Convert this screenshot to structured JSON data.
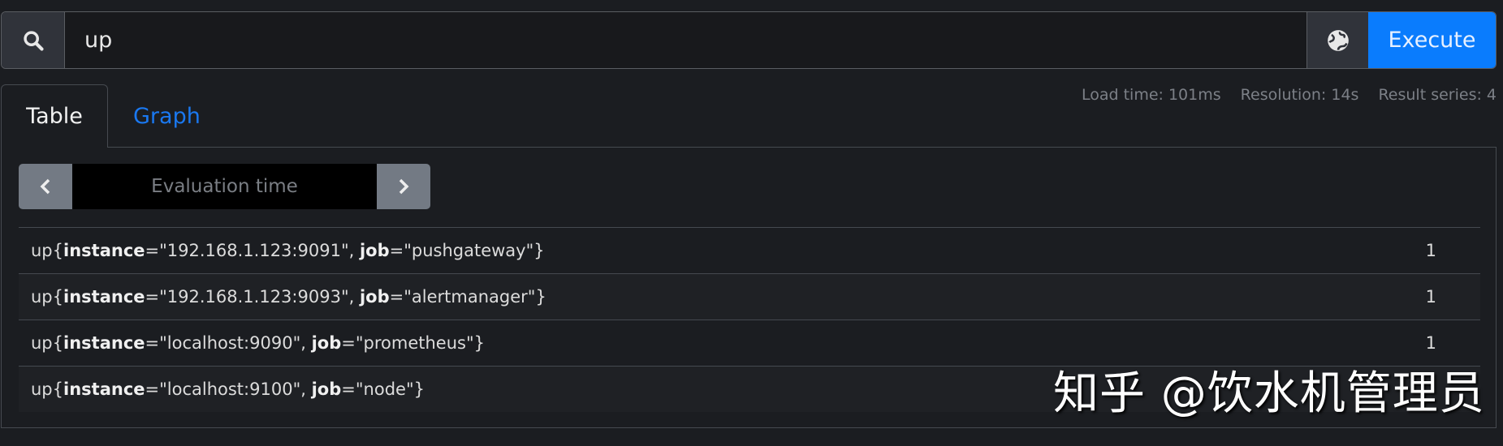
{
  "search": {
    "query": "up",
    "execute_label": "Execute",
    "icons": {
      "search": "search-icon",
      "globe": "globe-icon"
    }
  },
  "stats": {
    "load_time": "Load time: 101ms",
    "resolution": "Resolution: 14s",
    "result_series": "Result series: 4"
  },
  "tabs": [
    {
      "label": "Table",
      "active": true
    },
    {
      "label": "Graph",
      "active": false
    }
  ],
  "eval": {
    "placeholder": "Evaluation time"
  },
  "rows": [
    {
      "metric": "up",
      "labels": [
        {
          "k": "instance",
          "v": "192.168.1.123:9091"
        },
        {
          "k": "job",
          "v": "pushgateway"
        }
      ],
      "value": "1"
    },
    {
      "metric": "up",
      "labels": [
        {
          "k": "instance",
          "v": "192.168.1.123:9093"
        },
        {
          "k": "job",
          "v": "alertmanager"
        }
      ],
      "value": "1"
    },
    {
      "metric": "up",
      "labels": [
        {
          "k": "instance",
          "v": "localhost:9090"
        },
        {
          "k": "job",
          "v": "prometheus"
        }
      ],
      "value": "1"
    },
    {
      "metric": "up",
      "labels": [
        {
          "k": "instance",
          "v": "localhost:9100"
        },
        {
          "k": "job",
          "v": "node"
        }
      ],
      "value": ""
    }
  ],
  "watermark": "知乎 @饮水机管理员",
  "colors": {
    "accent": "#0a7cfd",
    "background": "#1b1d21"
  }
}
